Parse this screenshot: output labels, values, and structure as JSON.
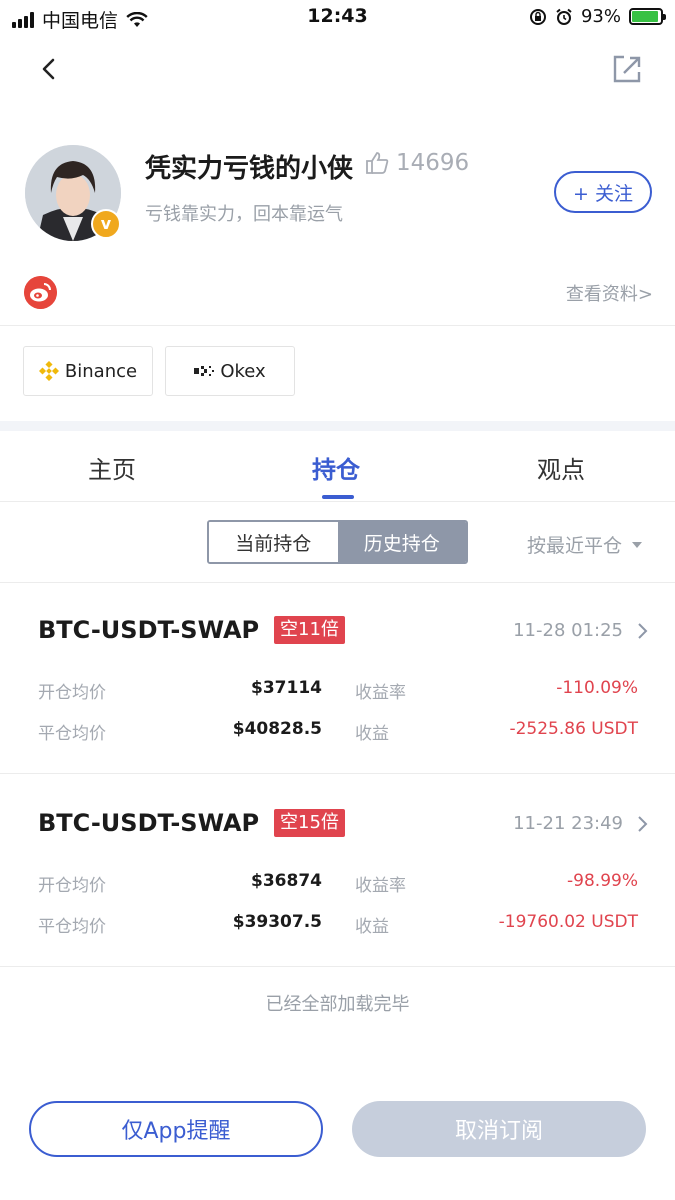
{
  "status_bar": {
    "carrier": "中国电信",
    "time": "12:43",
    "battery": "93%"
  },
  "nav": {
    "back_icon": "chevron-left-icon",
    "share_icon": "share-icon"
  },
  "profile": {
    "name": "凭实力亏钱的小侠",
    "likes": "14696",
    "bio": "亏钱靠实力，回本靠运气",
    "badge": "v",
    "follow_label": "+ 关注",
    "view_profile": "查看资料",
    "view_profile_arrow": ">"
  },
  "exchanges": [
    {
      "name": "Binance"
    },
    {
      "name": "Okex"
    }
  ],
  "tabs": [
    {
      "label": "主页",
      "active": false
    },
    {
      "label": "持仓",
      "active": true
    },
    {
      "label": "观点",
      "active": false
    }
  ],
  "segment": {
    "current": "当前持仓",
    "history": "历史持仓",
    "selected": "history"
  },
  "sort": {
    "label": "按最近平仓"
  },
  "positions": [
    {
      "pair": "BTC-USDT-SWAP",
      "leverage": "空11倍",
      "time": "11-28 01:25",
      "open_label": "开仓均价",
      "open_price": "$37114",
      "rate_label": "收益率",
      "rate": "-110.09%",
      "close_label": "平仓均价",
      "close_price": "$40828.5",
      "pnl_label": "收益",
      "pnl": "-2525.86 USDT"
    },
    {
      "pair": "BTC-USDT-SWAP",
      "leverage": "空15倍",
      "time": "11-21 23:49",
      "open_label": "开仓均价",
      "open_price": "$36874",
      "rate_label": "收益率",
      "rate": "-98.99%",
      "close_label": "平仓均价",
      "close_price": "$39307.5",
      "pnl_label": "收益",
      "pnl": "-19760.02 USDT"
    }
  ],
  "footer": {
    "loaded_text": "已经全部加载完毕",
    "remind_button": "仅App提醒",
    "unsubscribe_button": "取消订阅"
  },
  "colors": {
    "accent": "#3b5dd1",
    "negative": "#e0444e",
    "muted": "#9aa0a8",
    "disabled_button": "#c6cedc"
  }
}
